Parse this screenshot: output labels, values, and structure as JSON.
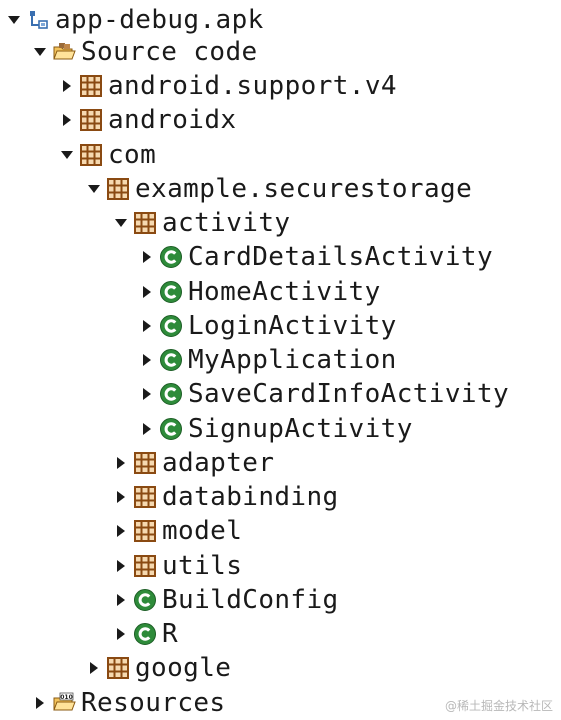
{
  "tree": {
    "nodes": [
      {
        "label": "app-debug.apk",
        "state": "expanded",
        "icon": "apk-project-icon"
      },
      {
        "label": "Source code",
        "state": "expanded",
        "icon": "source-folder-icon"
      },
      {
        "label": "android.support.v4",
        "state": "collapsed",
        "icon": "package-icon"
      },
      {
        "label": "androidx",
        "state": "collapsed",
        "icon": "package-icon"
      },
      {
        "label": "com",
        "state": "expanded",
        "icon": "package-icon"
      },
      {
        "label": "example.securestorage",
        "state": "expanded",
        "icon": "package-icon"
      },
      {
        "label": "activity",
        "state": "expanded",
        "icon": "package-icon"
      },
      {
        "label": "CardDetailsActivity",
        "state": "collapsed",
        "icon": "class-icon"
      },
      {
        "label": "HomeActivity",
        "state": "collapsed",
        "icon": "class-icon"
      },
      {
        "label": "LoginActivity",
        "state": "collapsed",
        "icon": "class-icon"
      },
      {
        "label": "MyApplication",
        "state": "collapsed",
        "icon": "class-icon"
      },
      {
        "label": "SaveCardInfoActivity",
        "state": "collapsed",
        "icon": "class-icon"
      },
      {
        "label": "SignupActivity",
        "state": "collapsed",
        "icon": "class-icon"
      },
      {
        "label": "adapter",
        "state": "collapsed",
        "icon": "package-icon"
      },
      {
        "label": "databinding",
        "state": "collapsed",
        "icon": "package-icon"
      },
      {
        "label": "model",
        "state": "collapsed",
        "icon": "package-icon"
      },
      {
        "label": "utils",
        "state": "collapsed",
        "icon": "package-icon"
      },
      {
        "label": "BuildConfig",
        "state": "collapsed",
        "icon": "class-icon"
      },
      {
        "label": "R",
        "state": "collapsed",
        "icon": "class-icon"
      },
      {
        "label": "google",
        "state": "collapsed",
        "icon": "package-icon"
      },
      {
        "label": "Resources",
        "state": "collapsed",
        "icon": "resources-folder-icon"
      }
    ]
  },
  "watermark": "@稀土掘金技术社区",
  "colors": {
    "package": "#8a4a12",
    "class_fill": "#2e8b3a",
    "folder": "#e8a93a",
    "arrow": "#1a1a1a"
  }
}
